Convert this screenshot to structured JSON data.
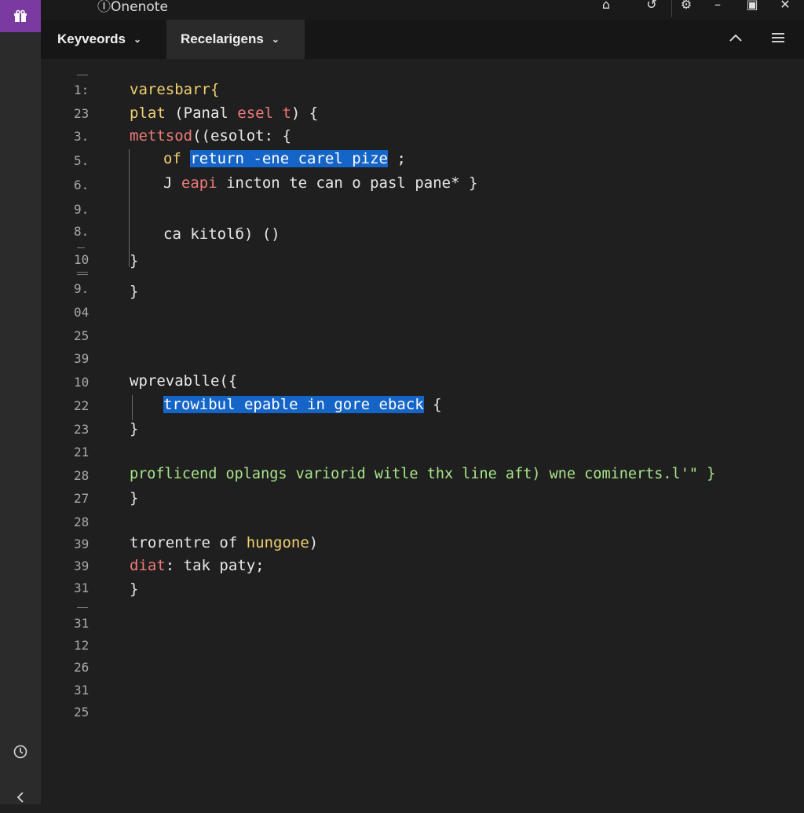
{
  "window": {
    "title": "Onenote",
    "controls": [
      "⌂",
      "↺",
      "⚙",
      "–",
      "▣",
      "✕"
    ]
  },
  "tabs": [
    {
      "label": "Keyveords",
      "active": false
    },
    {
      "label": "Recelarigens",
      "active": true
    }
  ],
  "toolbar": {
    "collapse_icon": "chevron-up-icon",
    "menu_icon": "hamburger-menu-icon"
  },
  "line_numbers": [
    "1:",
    "23",
    "3.",
    "5.",
    "6.",
    "9.",
    "8.",
    "10",
    "9.",
    "04",
    "25",
    "39",
    "10",
    "22",
    "23",
    "21",
    "28",
    "27",
    "28",
    "39",
    "39",
    "31",
    "31",
    "12",
    "26",
    "31",
    "25"
  ],
  "code": {
    "l1": "varesbarr{",
    "l2a": "plat",
    "l2b": " (Panal ",
    "l2c": "esel t",
    "l2d": ") {",
    "l3a": "mettsod",
    "l3b": "((esolot: {",
    "l4a": "of ",
    "l4sel": "return -ene carel pize",
    "l4b": " ;",
    "l5a": "J ",
    "l5b": "eapi",
    "l5c": " incton te can o pasl pane* }",
    "l6": "ca kitolб) ()",
    "l7": "}",
    "l8": "}",
    "l9": "wprevablle({",
    "l10sel": "trowibul epable in gore eback",
    "l10b": " {",
    "l11": "}",
    "l12": "proflicend oplangs variorid witle thx line aft) wne cominerts.l'\" }",
    "l13": "}",
    "l14a": "trorentre of ",
    "l14b": "hungone",
    "l14c": ")",
    "l15a": "diat",
    "l15b": ": tak paty;",
    "l16": "}"
  },
  "colors": {
    "selection": "#1565c8",
    "keyword": "#f0d070",
    "string": "#f07a7a",
    "comment": "#a9e58a",
    "app_accent": "#7a3aa0"
  }
}
